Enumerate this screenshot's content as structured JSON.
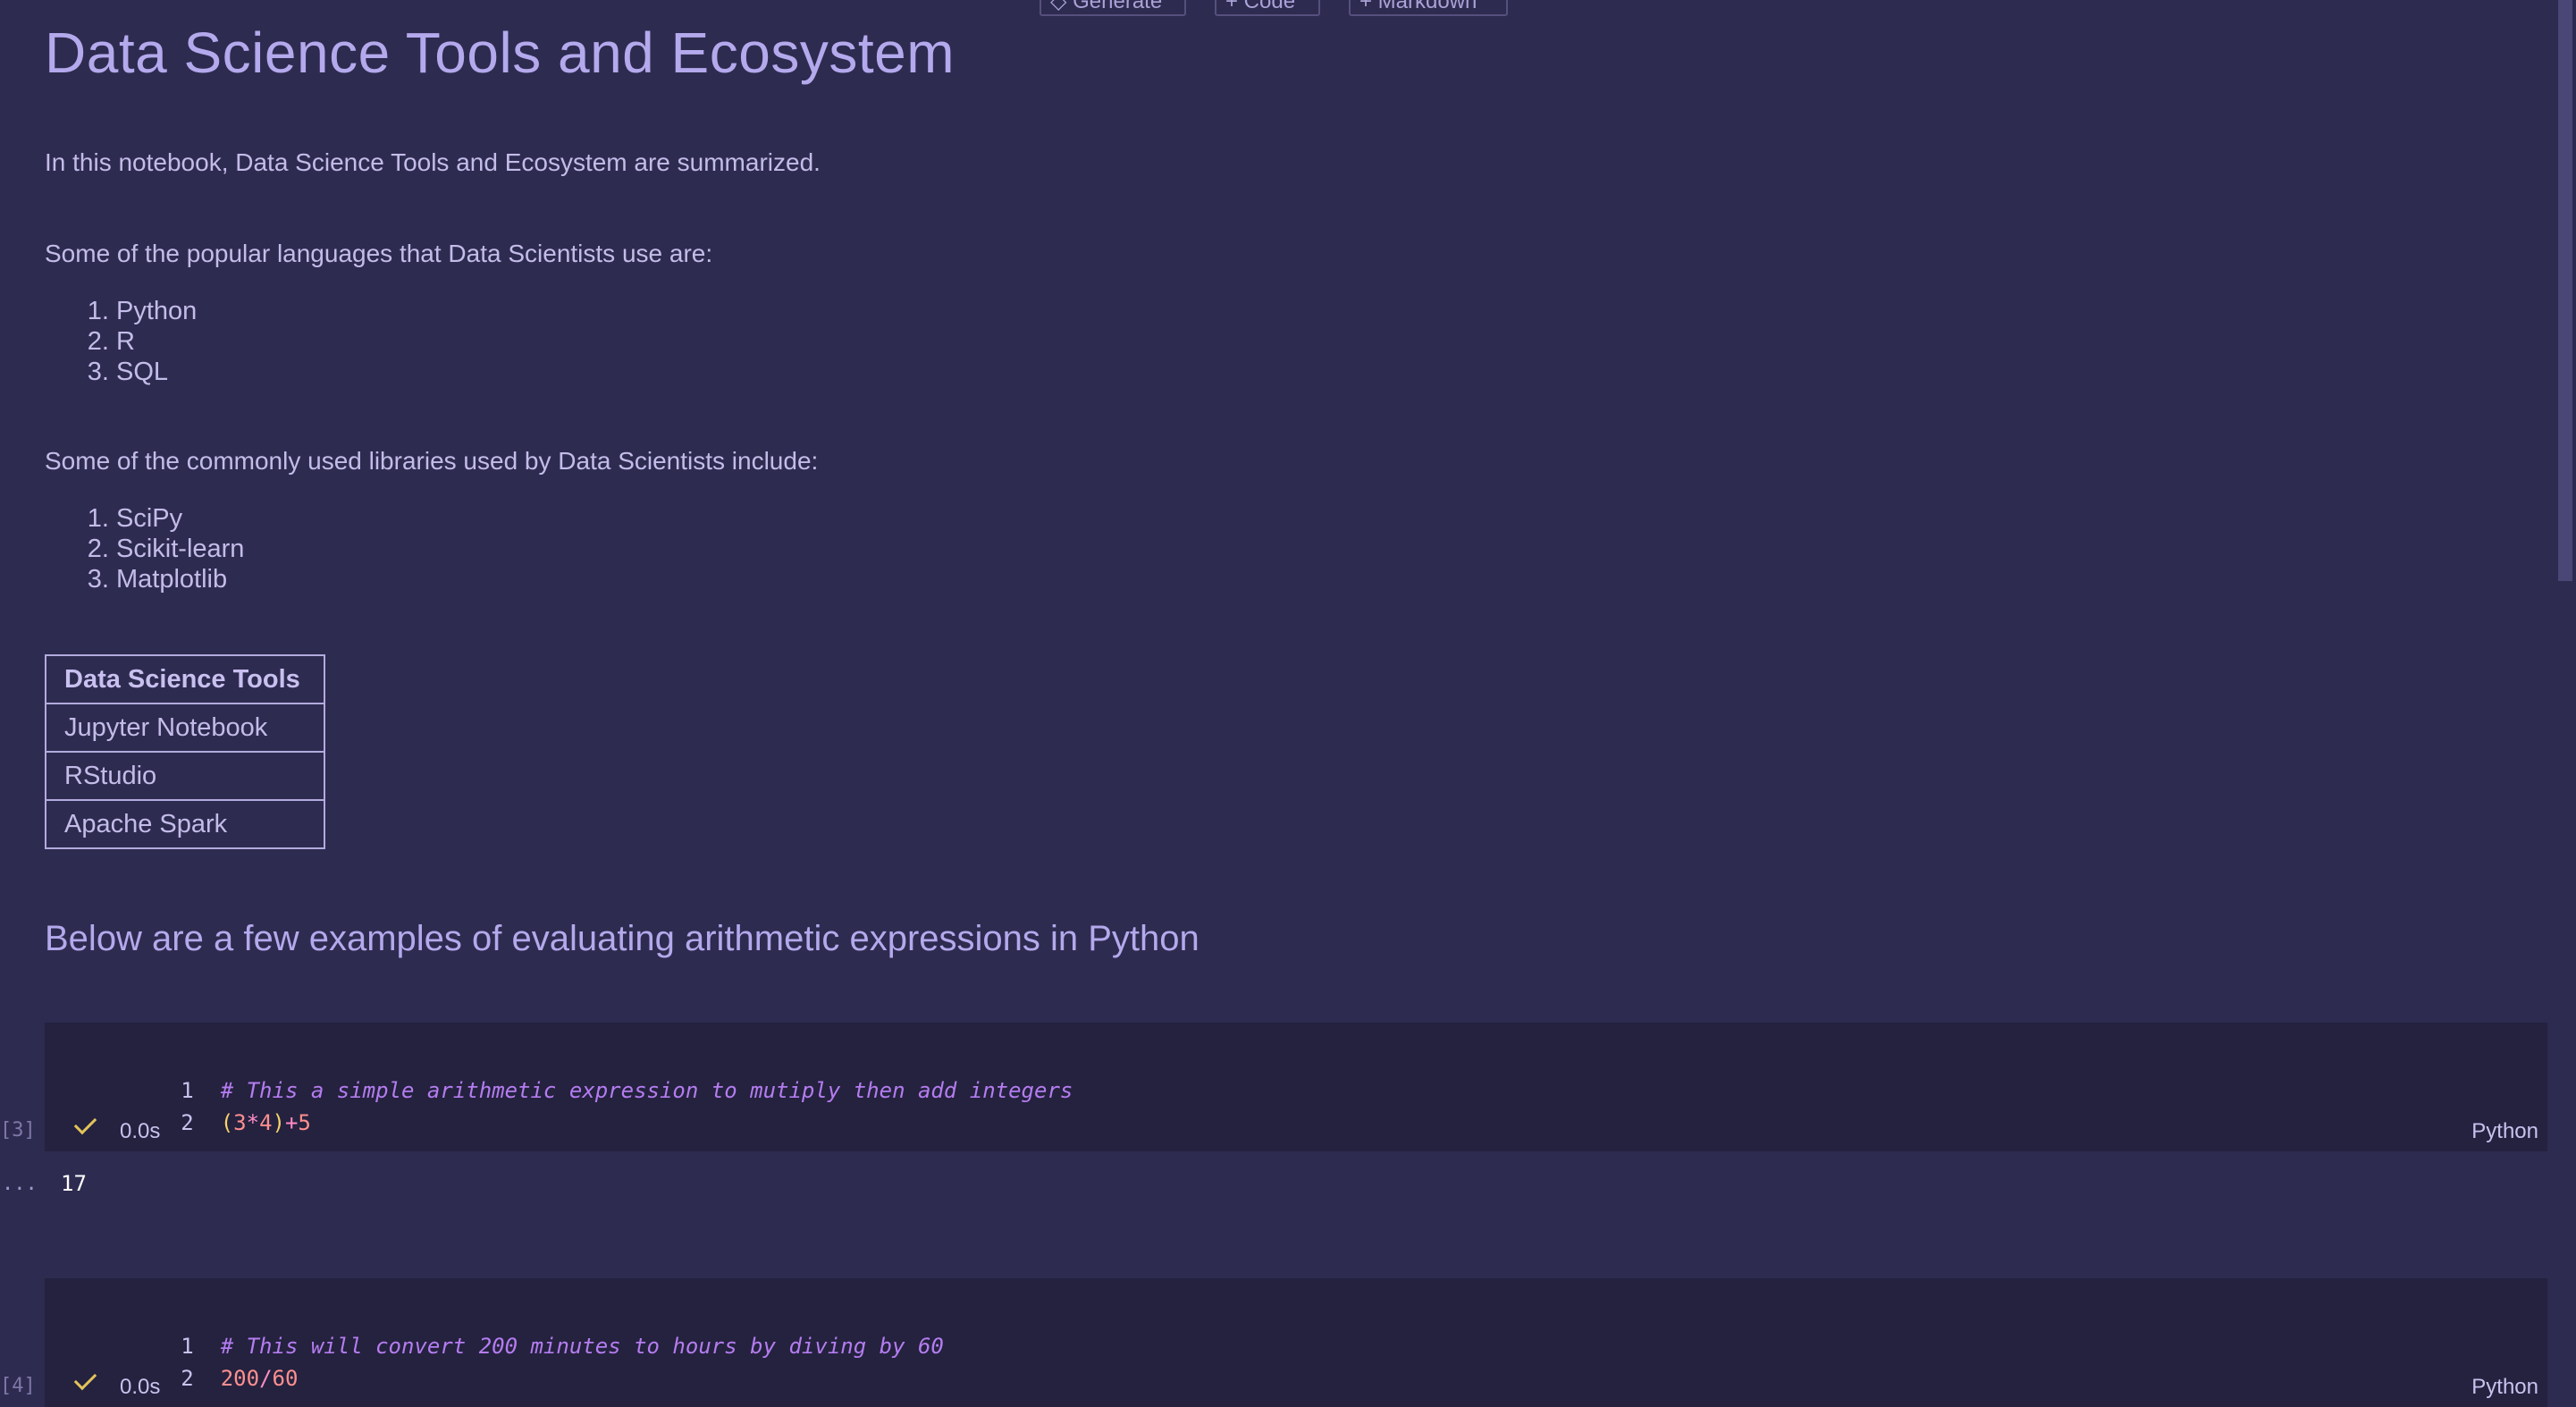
{
  "toolbar": {
    "generate_label": "◇ Generate",
    "code_label": "+ Code",
    "markdown_label": "+ Markdown"
  },
  "title": "Data Science Tools and Ecosystem",
  "intro": "In this notebook, Data Science Tools and Ecosystem are summarized.",
  "languages": {
    "heading": "Some of the popular languages that Data Scientists use are:",
    "items": [
      "Python",
      "R",
      "SQL"
    ]
  },
  "libraries": {
    "heading": "Some of the commonly used libraries used by Data Scientists include:",
    "items": [
      "SciPy",
      "Scikit-learn",
      "Matplotlib"
    ]
  },
  "tools_table": {
    "header": "Data Science Tools",
    "rows": [
      "Jupyter Notebook",
      "RStudio",
      "Apache Spark"
    ]
  },
  "arith_heading": "Below are a few examples of evaluating arithmetic expressions in Python",
  "cells": [
    {
      "exec_count": "[3]",
      "lines": [
        "1",
        "2"
      ],
      "comment": "# This a simple arithmetic expression to mutiply then add integers",
      "code": {
        "open": "(",
        "a": "3",
        "mul": "*",
        "b": "4",
        "close": ")",
        "plus": "+",
        "c": "5"
      },
      "time": "0.0s",
      "language": "Python",
      "output_marker": "...",
      "output": "17"
    },
    {
      "exec_count": "[4]",
      "lines": [
        "1",
        "2"
      ],
      "comment": "# This will convert 200 minutes to hours by diving by 60",
      "code": {
        "a": "200",
        "div": "/",
        "b": "60"
      },
      "time": "0.0s",
      "language": "Python"
    }
  ]
}
